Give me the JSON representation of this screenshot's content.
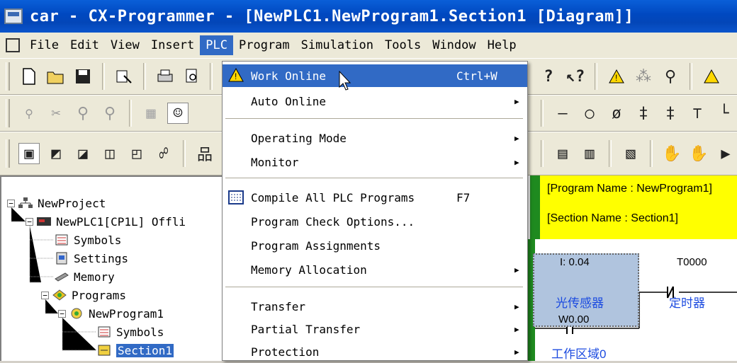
{
  "window": {
    "title": "car - CX-Programmer - [NewPLC1.NewProgram1.Section1 [Diagram]]"
  },
  "menubar": {
    "items": [
      "File",
      "Edit",
      "View",
      "Insert",
      "PLC",
      "Program",
      "Simulation",
      "Tools",
      "Window",
      "Help"
    ],
    "active": "PLC"
  },
  "plc_menu": {
    "items": [
      {
        "label": "Work Online",
        "shortcut": "Ctrl+W",
        "icon": "warning-icon",
        "submenu": false,
        "highlighted": true
      },
      {
        "label": "Auto Online",
        "shortcut": "",
        "submenu": true
      },
      {
        "label": "Operating Mode",
        "shortcut": "",
        "submenu": true
      },
      {
        "label": "Monitor",
        "shortcut": "",
        "submenu": true
      },
      {
        "label": "Compile All PLC Programs",
        "shortcut": "F7",
        "icon": "compile-icon",
        "submenu": false
      },
      {
        "label": "Program Check Options...",
        "shortcut": "",
        "submenu": false
      },
      {
        "label": "Program Assignments",
        "shortcut": "",
        "submenu": false
      },
      {
        "label": "Memory Allocation",
        "shortcut": "",
        "submenu": true
      },
      {
        "label": "Transfer",
        "shortcut": "",
        "submenu": true
      },
      {
        "label": "Partial Transfer",
        "shortcut": "",
        "submenu": true
      },
      {
        "label": "Protection",
        "shortcut": "",
        "submenu": true
      }
    ]
  },
  "tree": {
    "items": [
      {
        "label": "NewProject",
        "icon": "project-icon",
        "expander": "−"
      },
      {
        "label": "NewPLC1[CP1L] Offli",
        "icon": "plc-icon",
        "expander": "−"
      },
      {
        "label": "Symbols",
        "icon": "symbols-icon",
        "expander": ""
      },
      {
        "label": "Settings",
        "icon": "settings-icon",
        "expander": ""
      },
      {
        "label": "Memory",
        "icon": "memory-icon",
        "expander": ""
      },
      {
        "label": "Programs",
        "icon": "programs-icon",
        "expander": "−"
      },
      {
        "label": "NewProgram1",
        "icon": "program-icon",
        "expander": "−"
      },
      {
        "label": "Symbols",
        "icon": "symbols-icon",
        "expander": ""
      },
      {
        "label": "Section1",
        "icon": "section-icon",
        "expander": ""
      }
    ]
  },
  "diagram": {
    "program_name": "[Program Name : NewProgram1]",
    "section_name": "[Section Name : Section1]",
    "contact1_address": "I: 0.04",
    "contact1_comment": "光传感器",
    "contact2_address": "T0000",
    "contact2_comment": "定时器",
    "contact3_address": "W0.00",
    "contact3_comment": "工作区域0"
  }
}
